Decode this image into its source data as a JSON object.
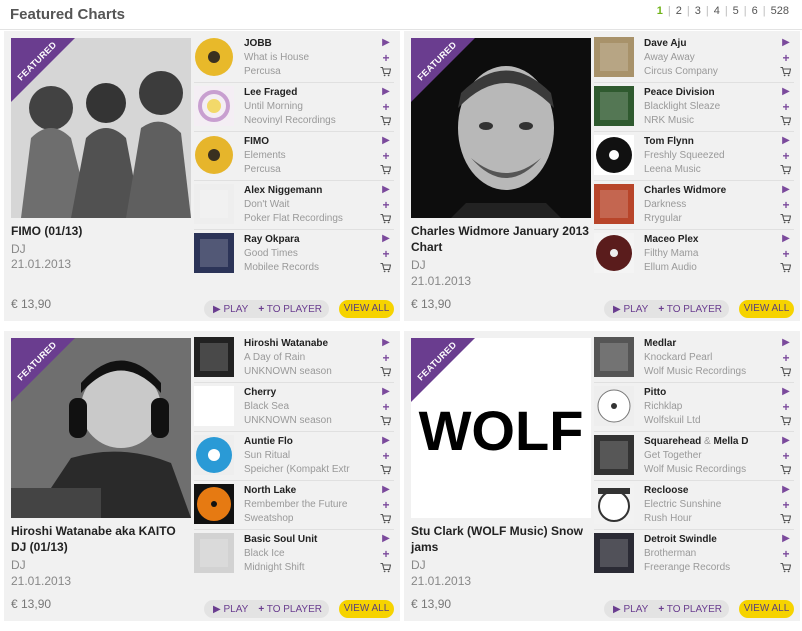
{
  "header": {
    "title": "Featured Charts",
    "pages": [
      "1",
      "2",
      "3",
      "4",
      "5",
      "6",
      "528"
    ],
    "current_page": "1"
  },
  "badge_label": "FEATURED",
  "controls": {
    "play": "PLAY",
    "to_player": "TO PLAYER",
    "view_all": "VIEW ALL"
  },
  "icons": {
    "play": "play-icon",
    "add": "plus-icon",
    "cart": "cart-icon"
  },
  "colors": {
    "accent": "#6a3d8f",
    "view_all": "#f6d300",
    "current_page": "#6fb317"
  },
  "charts": [
    {
      "title": "FIMO (01/13)",
      "genre": "DJ",
      "date": "21.01.2013",
      "price": "€ 13,90",
      "tracks": [
        {
          "artist": "JOBB",
          "title": "What is House",
          "label": "Percusa"
        },
        {
          "artist": "Lee Fraged",
          "title": "Until Morning",
          "label": "Neovinyl Recordings"
        },
        {
          "artist": "FIMO",
          "title": "Elements",
          "label": "Percusa"
        },
        {
          "artist": "Alex Niggemann",
          "title": "Don't Wait",
          "label": "Poker Flat Recordings"
        },
        {
          "artist": "Ray Okpara",
          "title": "Good Times",
          "label": "Mobilee Records"
        }
      ]
    },
    {
      "title": "Charles Widmore January 2013 Chart",
      "genre": "DJ",
      "date": "21.01.2013",
      "price": "€ 13,90",
      "tracks": [
        {
          "artist": "Dave Aju",
          "title": "Away Away",
          "label": "Circus Company"
        },
        {
          "artist": "Peace Division",
          "title": "Blacklight Sleaze",
          "label": "NRK Music"
        },
        {
          "artist": "Tom Flynn",
          "title": "Freshly Squeezed",
          "label": "Leena Music"
        },
        {
          "artist": "Charles Widmore",
          "title": "Darkness",
          "label": "Rrygular"
        },
        {
          "artist": "Maceo Plex",
          "title": "Filthy Mama",
          "label": "Ellum Audio"
        }
      ]
    },
    {
      "title": "Hiroshi Watanabe aka KAITO DJ (01/13)",
      "genre": "DJ",
      "date": "21.01.2013",
      "price": "€ 13,90",
      "tracks": [
        {
          "artist": "Hiroshi Watanabe",
          "title": "A Day of Rain",
          "label": "UNKNOWN season"
        },
        {
          "artist": "Cherry",
          "title": "Black Sea",
          "label": "UNKNOWN season"
        },
        {
          "artist": "Auntie Flo",
          "title": "Sun Ritual",
          "label": "Speicher (Kompakt Extr"
        },
        {
          "artist": "North Lake",
          "title": "Rembember the Future",
          "label": "Sweatshop"
        },
        {
          "artist": "Basic Soul Unit",
          "title": "Black Ice",
          "label": "Midnight Shift"
        }
      ]
    },
    {
      "title": "Stu Clark (WOLF Music) Snow jams",
      "genre": "DJ",
      "date": "21.01.2013",
      "price": "€ 13,90",
      "art_text": "WOLF",
      "tracks": [
        {
          "artist": "Medlar",
          "title": "Knockard Pearl",
          "label": "Wolf Music Recordings"
        },
        {
          "artist": "Pitto",
          "title": "Richklap",
          "label": "Wolfskuil Ltd"
        },
        {
          "artist": "Squarehead",
          "artist2": "Mella D",
          "amp": "&",
          "title": "Get Together",
          "label": "Wolf Music Recordings"
        },
        {
          "artist": "Recloose",
          "title": "Electric Sunshine",
          "label": "Rush Hour"
        },
        {
          "artist": "Detroit Swindle",
          "title": "Brotherman",
          "label": "Freerange Records"
        }
      ]
    }
  ]
}
